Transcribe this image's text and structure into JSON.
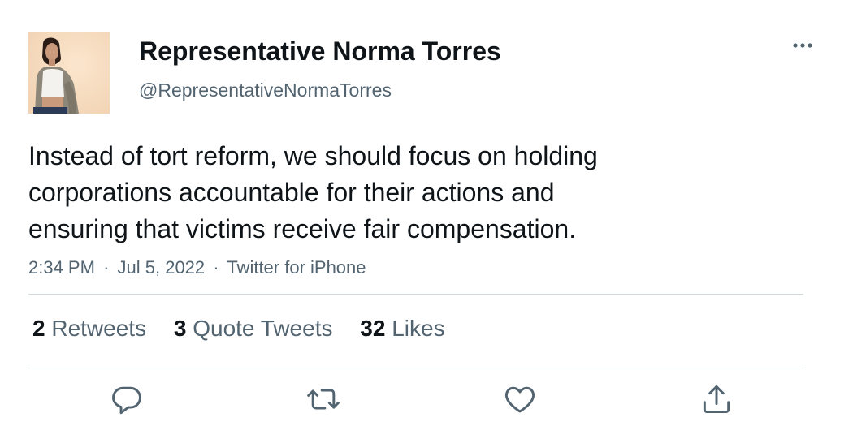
{
  "author": {
    "display_name": "Representative Norma Torres",
    "handle": "@RepresentativeNormaTorres",
    "avatar": "profile-photo"
  },
  "tweet": {
    "text_lines": [
      "Instead of tort reform, we should focus on holding",
      "corporations accountable for their actions and",
      "ensuring that victims receive fair compensation."
    ],
    "time": "2:34 PM",
    "date": "Jul 5, 2022",
    "source": "Twitter for iPhone",
    "separator": "·"
  },
  "stats": {
    "retweets_count": "2",
    "retweets_label": "Retweets",
    "quotes_count": "3",
    "quotes_label": "Quote Tweets",
    "likes_count": "32",
    "likes_label": "Likes"
  },
  "icons": {
    "more": "more-dots-icon",
    "reply": "reply-icon",
    "retweet": "retweet-icon",
    "like": "heart-icon",
    "share": "share-icon"
  },
  "colors": {
    "primary_text": "#0f1419",
    "secondary_text": "#536471",
    "divider": "#cfd9de",
    "icon": "#536471"
  }
}
